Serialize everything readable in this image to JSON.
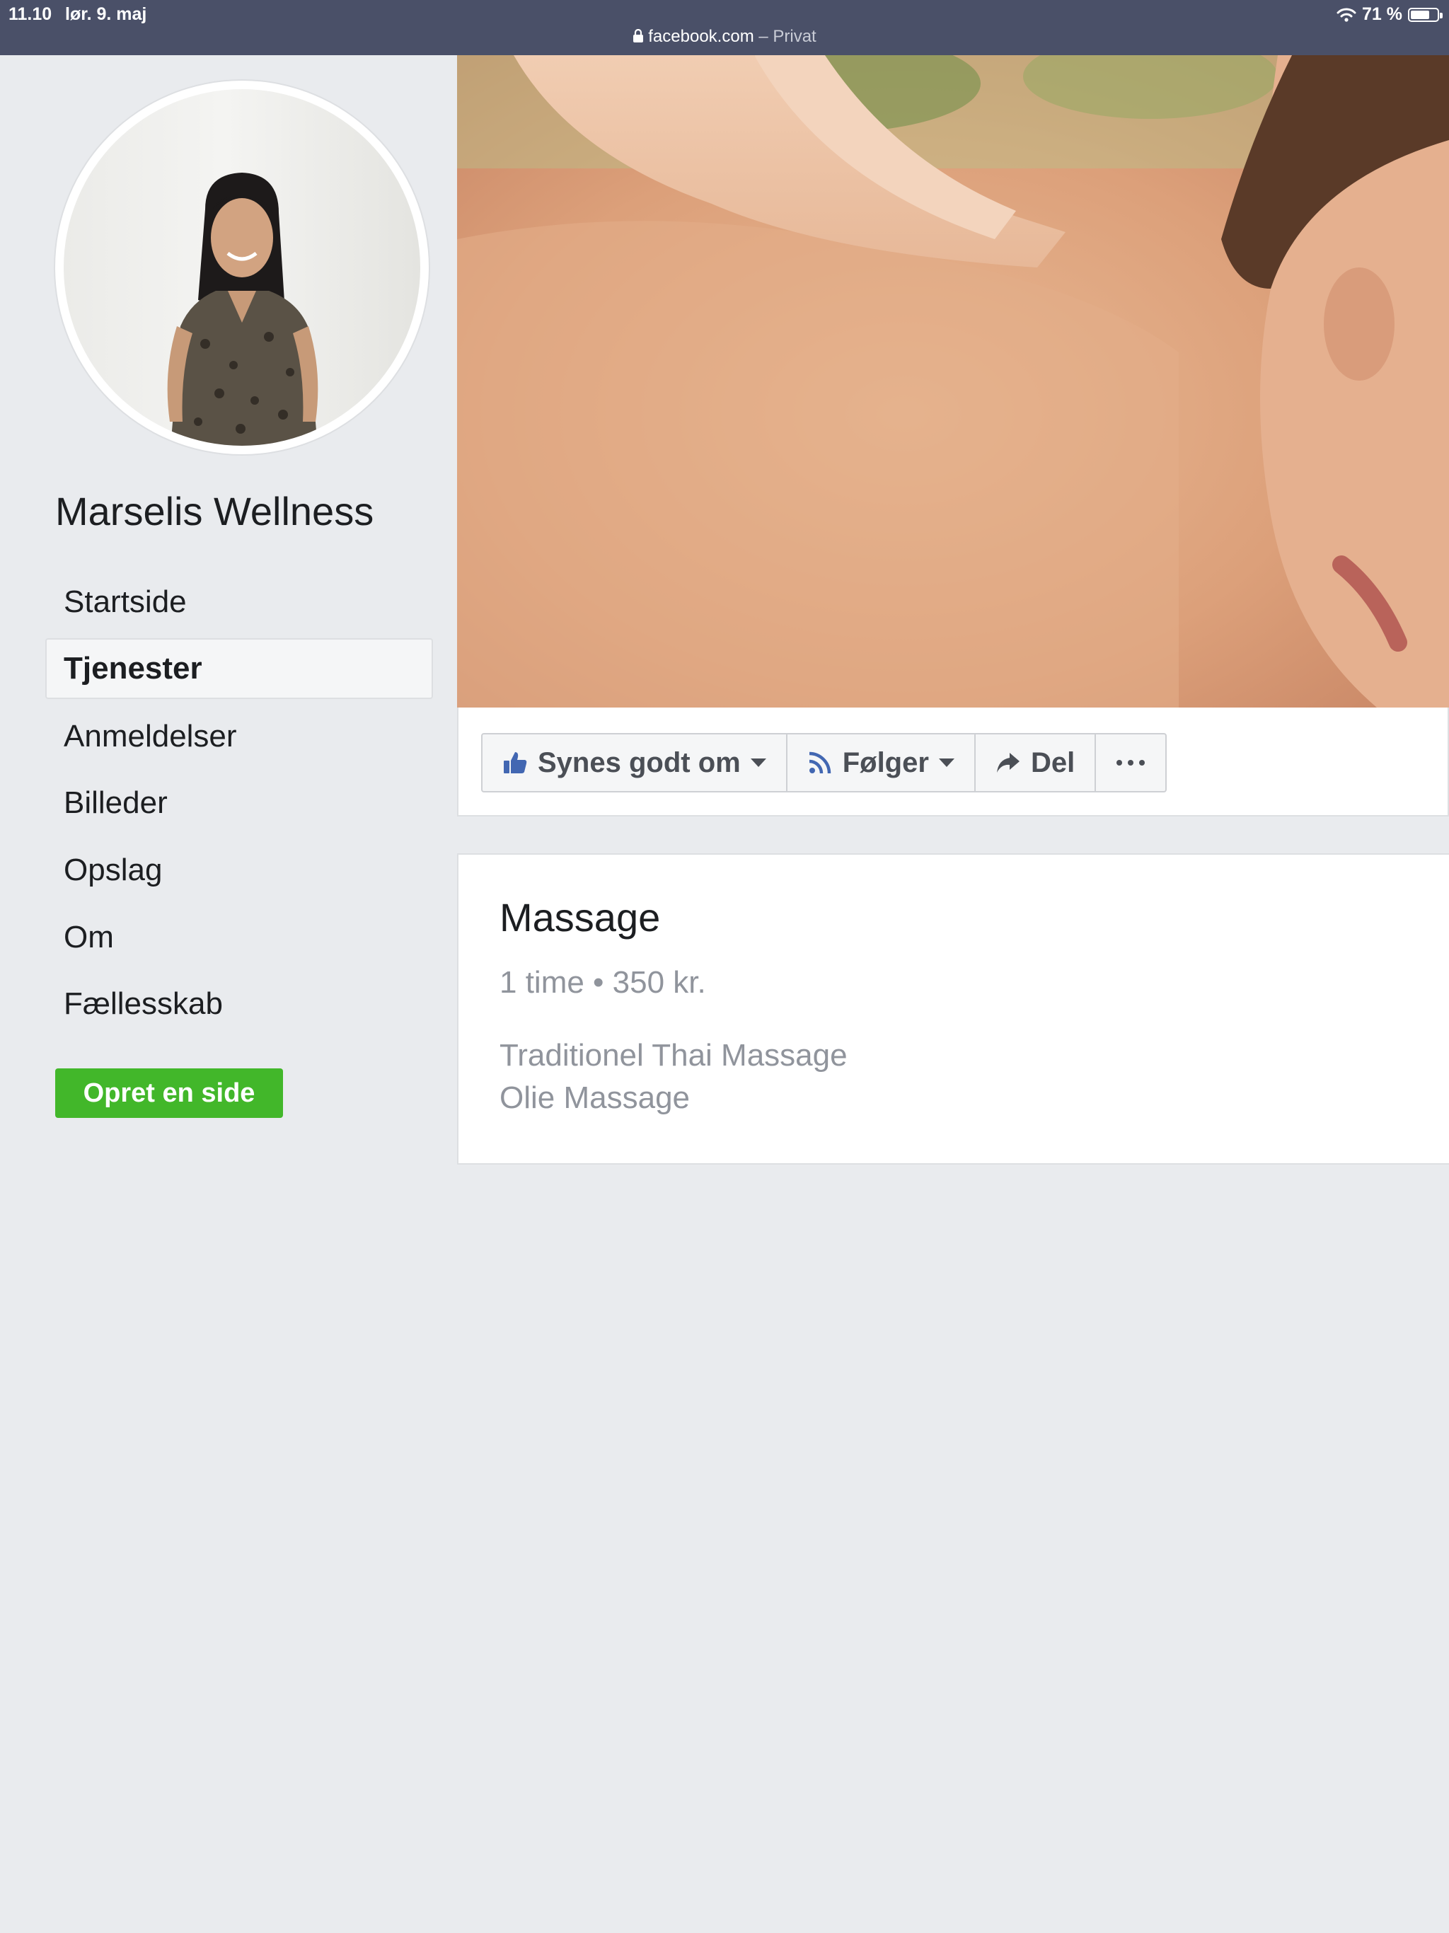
{
  "status_bar": {
    "time": "11.10",
    "date": "lør. 9. maj",
    "url_domain": "facebook.com",
    "url_mode": " – Privat",
    "battery": "71 %",
    "battery_level": 0.71
  },
  "page": {
    "name": "Marselis Wellness"
  },
  "nav": {
    "items": [
      {
        "label": "Startside"
      },
      {
        "label": "Tjenester"
      },
      {
        "label": "Anmeldelser"
      },
      {
        "label": "Billeder"
      },
      {
        "label": "Opslag"
      },
      {
        "label": "Om"
      },
      {
        "label": "Fællesskab"
      }
    ],
    "active": "Tjenester"
  },
  "create_page_button": "Opret en side",
  "actions": {
    "like": "Synes godt om",
    "follow": "Følger",
    "share": "Del"
  },
  "service": {
    "title": "Massage",
    "meta": "1 time • 350 kr.",
    "description_lines": [
      "Traditionel Thai Massage",
      "Olie Massage"
    ]
  },
  "colors": {
    "status_bar": "#4a5068",
    "background": "#e9ebee",
    "create_button": "#42b72a",
    "like_icon": "#4267b2"
  }
}
